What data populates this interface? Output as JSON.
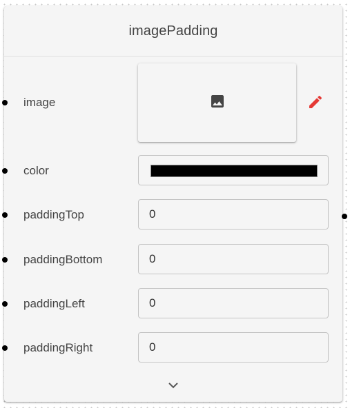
{
  "node": {
    "title": "imagePadding",
    "rows": {
      "image": {
        "label": "image",
        "icon": "image-icon",
        "edit_icon": "pencil-icon"
      },
      "color": {
        "label": "color",
        "value": "#000000"
      },
      "paddingTop": {
        "label": "paddingTop",
        "value": "0"
      },
      "paddingBottom": {
        "label": "paddingBottom",
        "value": "0"
      },
      "paddingLeft": {
        "label": "paddingLeft",
        "value": "0"
      },
      "paddingRight": {
        "label": "paddingRight",
        "value": "0"
      }
    },
    "expand_icon": "chevron-down-icon"
  },
  "colors": {
    "node_background": "#f5f5f5",
    "socket": "#000000",
    "edit_accent": "#e53935",
    "icon_dark": "#444444"
  }
}
